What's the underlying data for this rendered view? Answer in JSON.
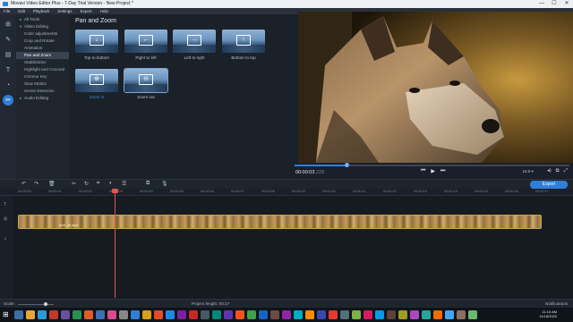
{
  "window": {
    "title": "Movavi Video Editor Plus - 7-Day Trial Version - New Project *",
    "controls": [
      "—",
      "☐",
      "✕"
    ]
  },
  "menu": [
    "File",
    "Edit",
    "Playback",
    "Settings",
    "Export",
    "Help"
  ],
  "categories": [
    {
      "label": "All Tools",
      "level": "parent",
      "arrow": "▸"
    },
    {
      "label": "Video Editing",
      "level": "parent",
      "arrow": "▾"
    },
    {
      "label": "Color adjustments",
      "level": "sub"
    },
    {
      "label": "Crop and Rotate",
      "level": "sub"
    },
    {
      "label": "Animation",
      "level": "sub"
    },
    {
      "label": "Pan and Zoom",
      "level": "sub",
      "selected": true
    },
    {
      "label": "Stabilization",
      "level": "sub"
    },
    {
      "label": "Highlight and Conceal",
      "level": "sub"
    },
    {
      "label": "Chroma Key",
      "level": "sub"
    },
    {
      "label": "Slow Motion",
      "level": "sub"
    },
    {
      "label": "Scene Detection",
      "level": "sub"
    },
    {
      "label": "Audio Editing",
      "level": "parent",
      "arrow": "▸"
    }
  ],
  "effects": {
    "heading": "Pan and Zoom",
    "tiles": [
      {
        "label": "Top to bottom",
        "icon": "↓"
      },
      {
        "label": "Right to left",
        "icon": "←"
      },
      {
        "label": "Left to right",
        "icon": "→"
      },
      {
        "label": "Bottom to top",
        "icon": "↑"
      },
      {
        "label": "Zoom in",
        "icon": "⊕",
        "highlight": true
      },
      {
        "label": "Zoom out",
        "icon": "⊖",
        "selected": true
      }
    ]
  },
  "preview": {
    "timecode": "00:00:03",
    "timecode_frac": ".228",
    "progress": 0.19,
    "aspect": "16:9 ▾",
    "controls": {
      "prev": "⏮",
      "play": "▶",
      "next": "⏭"
    }
  },
  "toolbar": {
    "export_label": "Export"
  },
  "ruler": [
    "00:00:00",
    "00:00:01",
    "00:00:02",
    "00:00:03",
    "00:00:04",
    "00:00:05",
    "00:00:06",
    "00:00:07",
    "00:00:08",
    "00:00:09",
    "00:00:10",
    "00:00:11",
    "00:00:12",
    "00:00:13",
    "00:00:14",
    "00:00:15",
    "00:00:16",
    "00:00:17"
  ],
  "clip": {
    "title": "wolf_4k.mp4"
  },
  "status": {
    "scale_label": "Scale:",
    "project_length": "Project length:  00:17",
    "notifications": "Notifications"
  },
  "taskbar": {
    "time": "11:16 AM",
    "date": "11/18/2020",
    "icon_colors": [
      "#3a6ea5",
      "#e8a33a",
      "#2b9bd8",
      "#c0392b",
      "#6b4fa0",
      "#2d8f52",
      "#e25a2c",
      "#3d6fb6",
      "#d94a8c",
      "#888888",
      "#2f7fd6",
      "#d4a017",
      "#e34c26",
      "#1e88e5",
      "#7b1fa2",
      "#c62828",
      "#455a64",
      "#00897b",
      "#5e35b1",
      "#f4511e",
      "#43a047",
      "#1565c0",
      "#6d4c41",
      "#8e24aa",
      "#00acc1",
      "#fb8c00",
      "#3949ab",
      "#e53935",
      "#546e7a",
      "#7cb342",
      "#d81b60",
      "#039be5",
      "#5d4037",
      "#9e9d24",
      "#ab47bc",
      "#26a69a",
      "#ef6c00",
      "#42a5f5",
      "#8d6e63",
      "#66bb6a"
    ]
  }
}
